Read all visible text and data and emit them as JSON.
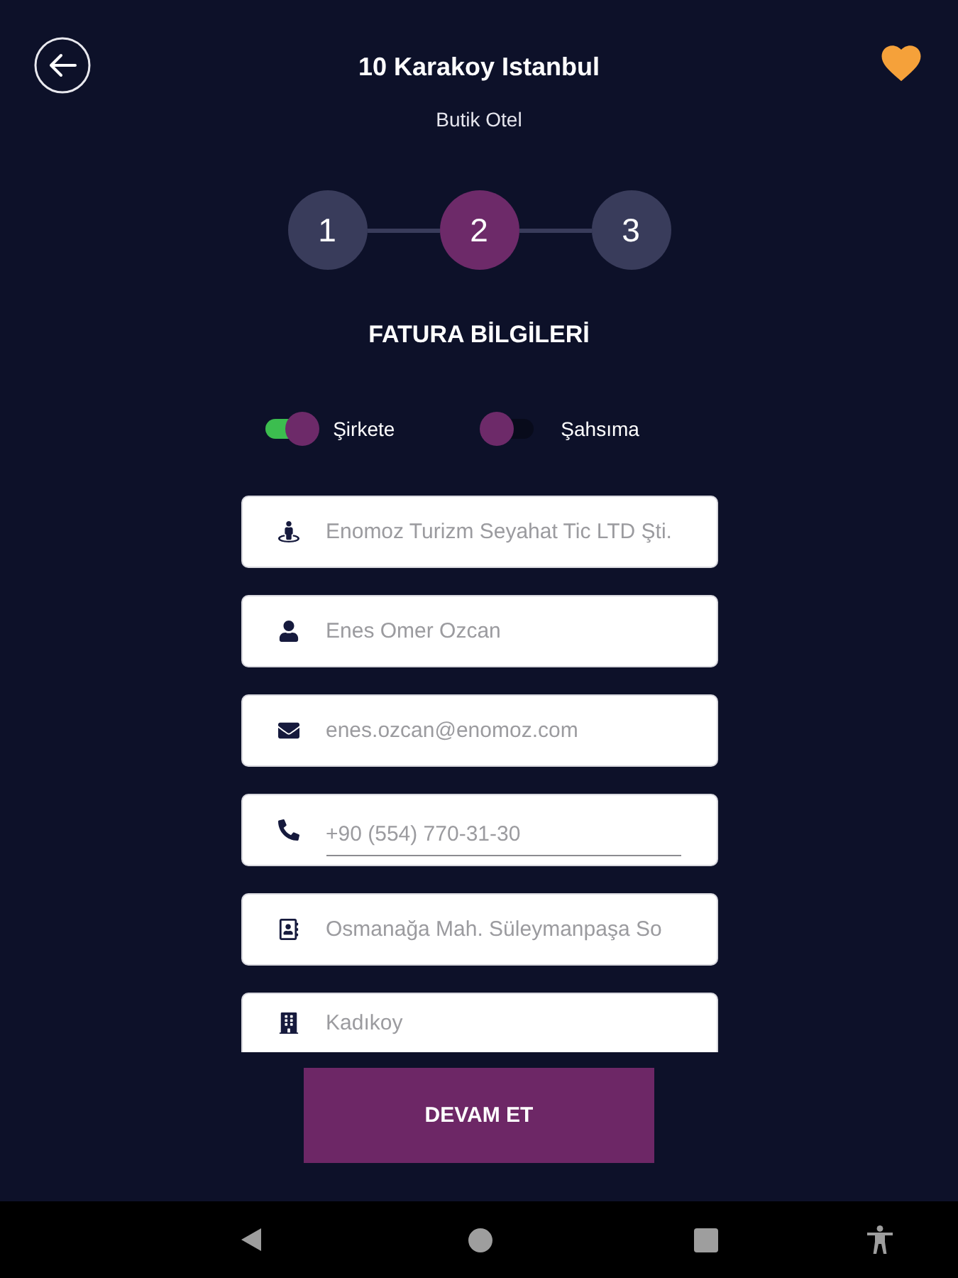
{
  "header": {
    "title": "10 Karakoy Istanbul",
    "subtitle": "Butik Otel",
    "favorite": true
  },
  "steps": [
    {
      "label": "1",
      "selected": false
    },
    {
      "label": "2",
      "selected": true
    },
    {
      "label": "3",
      "selected": false
    }
  ],
  "section_title": "FATURA BİLGİLERİ",
  "invoice_types": [
    {
      "label": "Şirkete",
      "on": true
    },
    {
      "label": "Şahsıma",
      "on": false
    }
  ],
  "fields": [
    {
      "kind": "company",
      "value": "Enomoz Turizm Seyahat Tic LTD Şti."
    },
    {
      "kind": "person",
      "value": "Enes Omer Ozcan"
    },
    {
      "kind": "email",
      "value": "enes.ozcan@enomoz.com"
    },
    {
      "kind": "phone",
      "value": "+90 (554) 770-31-30"
    },
    {
      "kind": "address",
      "value": "Osmanağa Mah. Süleymanpaşa So"
    },
    {
      "kind": "city",
      "value": "Kadıkoy"
    }
  ],
  "button": "DEVAM ET"
}
